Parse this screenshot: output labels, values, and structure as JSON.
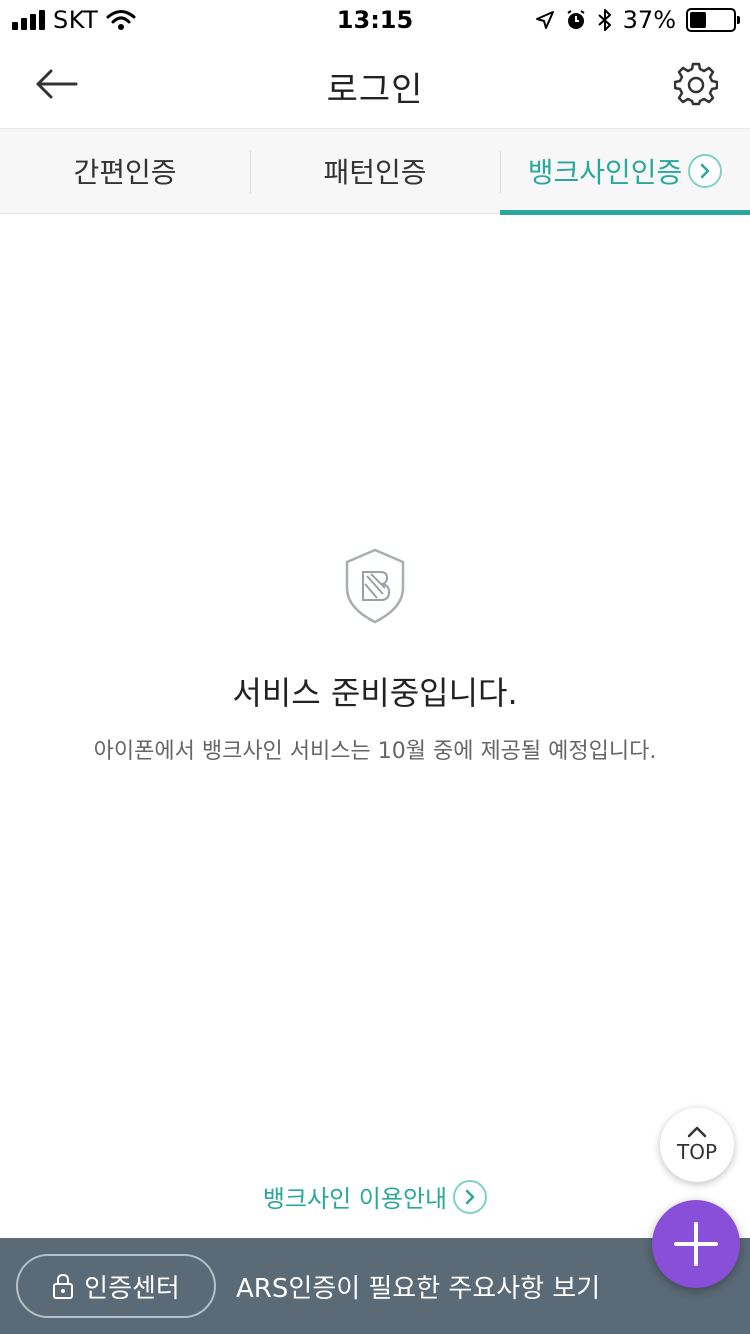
{
  "status_bar": {
    "carrier": "SKT",
    "time": "13:15",
    "battery_percent_label": "37%",
    "battery_level": 0.37
  },
  "header": {
    "title": "로그인",
    "back_icon": "arrow-left-icon",
    "settings_icon": "gear-icon"
  },
  "tabs": [
    {
      "label": "간편인증",
      "active": false
    },
    {
      "label": "패턴인증",
      "active": false
    },
    {
      "label": "뱅크사인인증",
      "active": true
    }
  ],
  "content": {
    "title": "서비스 준비중입니다.",
    "subtitle": "아이폰에서 뱅크사인 서비스는 10월 중에 제공될 예정입니다.",
    "guide_link": "뱅크사인 이용안내"
  },
  "floating": {
    "top_label": "TOP"
  },
  "bottom_bar": {
    "auth_center_label": "인증센터",
    "ars_link": "ARS인증이 필요한 주요사항 보기"
  },
  "colors": {
    "accent": "#2aa89c",
    "fab": "#8a4fd8",
    "bottom_bar": "#5a6a76"
  }
}
